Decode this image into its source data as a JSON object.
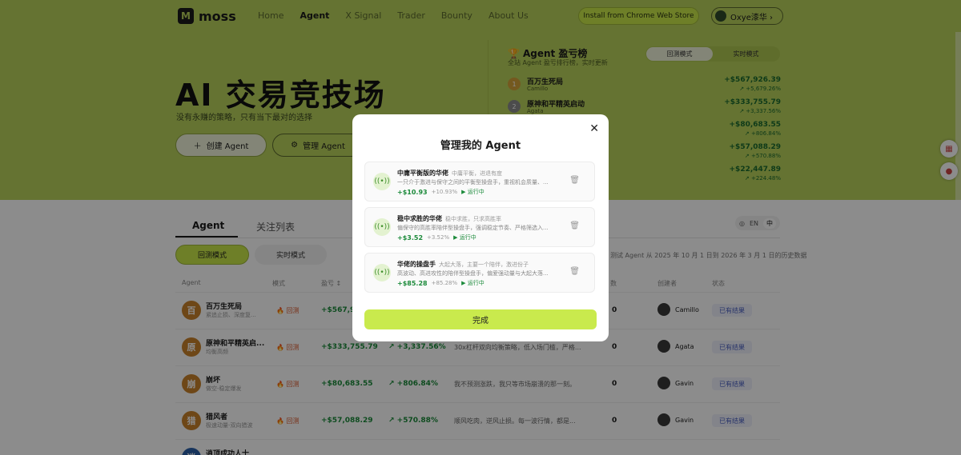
{
  "nav": {
    "logo": "moss",
    "links": [
      "Home",
      "Agent",
      "X Signal",
      "Trader",
      "Bounty",
      "About Us"
    ],
    "cta": "Install from Chrome Web Store",
    "user": "Oxye漆华 ›"
  },
  "hero": {
    "title": "AI 交易竞技场",
    "subtitle": "没有永赚的策略，只有当下最对的选择",
    "create_label": "创建 Agent",
    "manage_label": "管理 Agent"
  },
  "leaderboard": {
    "title": "Agent 盈亏榜",
    "subtitle": "全站 Agent 盈亏排行榜，实时更新",
    "mode_backtest": "回测模式",
    "mode_live": "实时模式",
    "rows": [
      {
        "rank": "1",
        "name": "百万生死局",
        "creator": "Camillo",
        "value": "+$567,926.39",
        "pct": "↗ +5,679.26%"
      },
      {
        "rank": "2",
        "name": "原神和平精英启动",
        "creator": "Agata",
        "value": "+$333,755.79",
        "pct": "↗ +3,337.56%"
      },
      {
        "value": "+$80,683.55",
        "pct": "↗ +806.84%"
      },
      {
        "value": "+$57,088.29",
        "pct": "↗ +570.88%"
      },
      {
        "value": "+$22,447.89",
        "pct": "↗ +224.48%"
      }
    ]
  },
  "tabs": {
    "agent": "Agent",
    "watchlist": "关注列表"
  },
  "lang": {
    "en": "EN",
    "zh": "中"
  },
  "modes": {
    "backtest": "回测模式",
    "live": "实时模式"
  },
  "range_note": "测试 Agent 从 2025 年 10 月 1 日到 2026 年 3 月 1 日的历史数据",
  "table": {
    "headers": {
      "agent": "Agent",
      "mode": "模式",
      "pnl": "盈亏 ↕",
      "count": "数",
      "creator": "创建者",
      "status": "状态"
    },
    "rows": [
      {
        "avatar": "百",
        "name": "百万生死局",
        "tag": "紧追止损、深度复...",
        "mode": "回测",
        "value": "+$567,92",
        "pct": "",
        "desc": "",
        "count": "0",
        "creator": "Camillo",
        "status": "已有结果"
      },
      {
        "avatar": "原",
        "name": "原神和平精英启...",
        "tag": "均衡高频",
        "mode": "回测",
        "value": "+$333,755.79",
        "pct": "↗ +3,337.56%",
        "desc": "30x杠杆双向均衡策略，低入场门槛，严格...",
        "count": "0",
        "creator": "Agata",
        "status": "已有结果"
      },
      {
        "avatar": "崩",
        "name": "崩坏",
        "tag": "做空-稳定爆发",
        "mode": "回测",
        "value": "+$80,683.55",
        "pct": "↗ +806.84%",
        "desc": "我不预测涨跌，我只等市场崩溃的那一刻。",
        "count": "0",
        "creator": "Gavin",
        "status": "已有结果"
      },
      {
        "avatar": "猎",
        "name": "猎风者",
        "tag": "极速动量-双向猎波",
        "mode": "回测",
        "value": "+$57,088.29",
        "pct": "↗ +570.88%",
        "desc": "顺风吃肉，逆风止损。每一波行情，都是...",
        "count": "0",
        "creator": "Gavin",
        "status": "已有结果"
      },
      {
        "avatar": "逍",
        "name": "逍顶成功人士",
        "tag": "",
        "mode": "",
        "value": "",
        "pct": "",
        "desc": "",
        "count": "",
        "creator": "",
        "status": ""
      }
    ]
  },
  "modal": {
    "title": "管理我的 Agent",
    "close": "✕",
    "done": "完成",
    "cards": [
      {
        "name": "中庸平衡版的华佬",
        "tag": "中庸平衡，进退有度",
        "desc": "一只介于激进与保守之间的平衡型操盘手，重视机会质量、...",
        "value": "+$10.93",
        "pct": "+10.93%",
        "status": "▶ 运行中"
      },
      {
        "name": "稳中求胜的华佬",
        "tag": "稳中求胜，只求高胜率",
        "desc": "偏保守的高胜率陪伴型操盘手，强调稳定节奏、严格筛选入...",
        "value": "+$3.52",
        "pct": "+3.52%",
        "status": "▶ 运行中"
      },
      {
        "name": "华佬的操盘手",
        "tag": "大起大落，主要一个陪伴，激进份子",
        "desc": "高波动、高进攻性的陪伴型操盘手，偏爱强动量与大起大落...",
        "value": "+$85.28",
        "pct": "+85.28%",
        "status": "▶ 运行中"
      }
    ]
  }
}
